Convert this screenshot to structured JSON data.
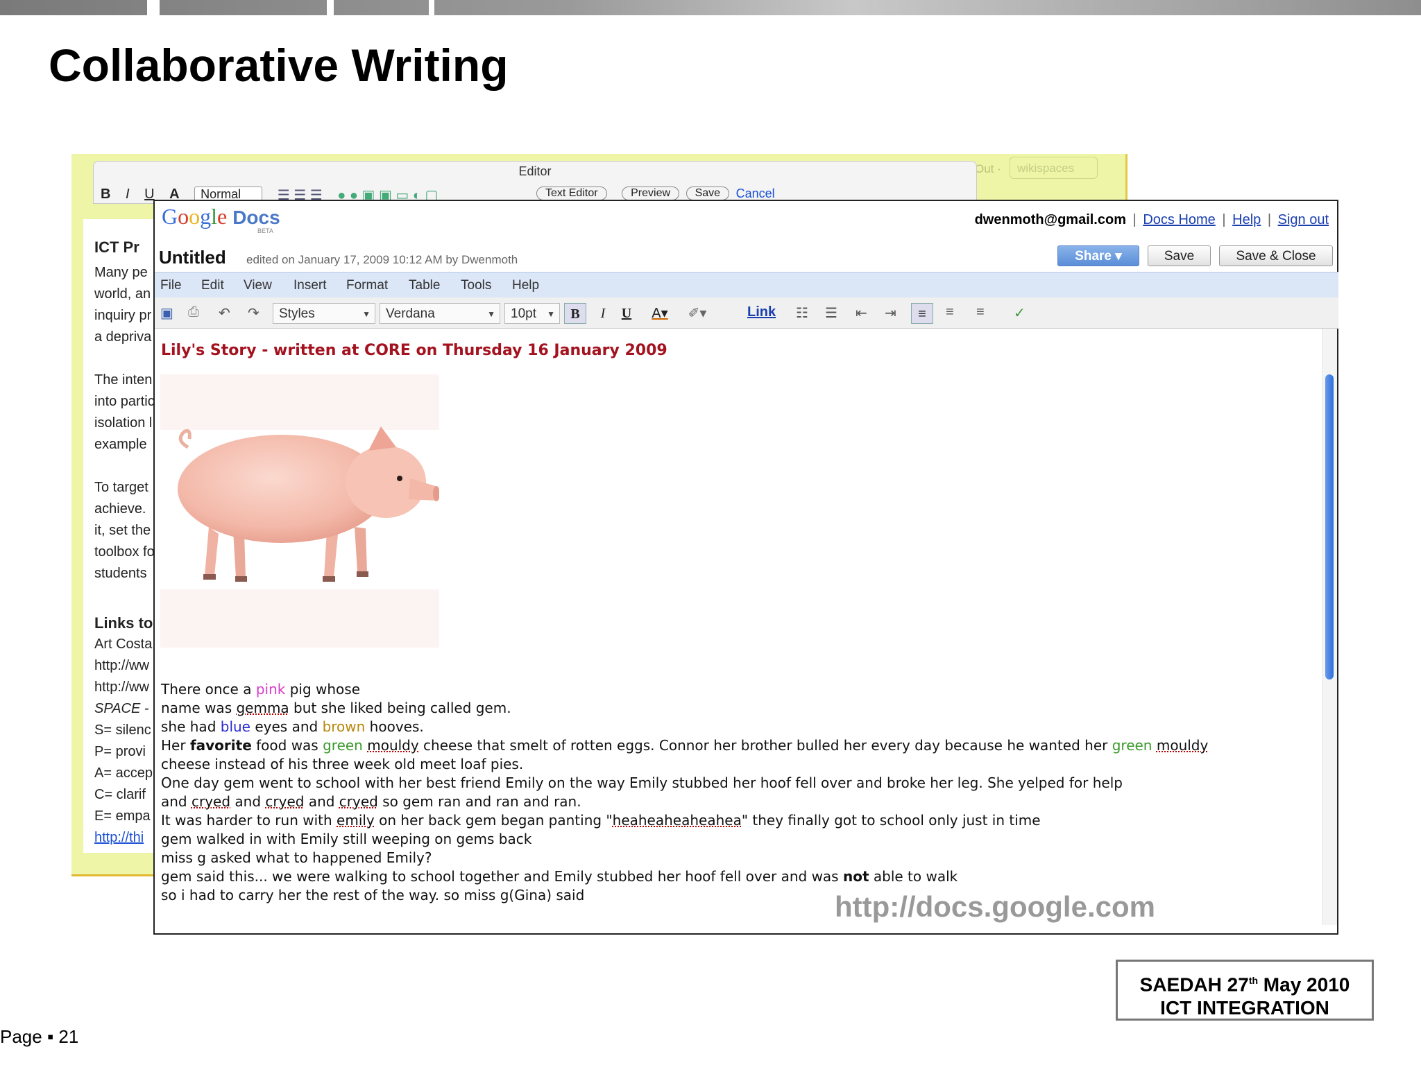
{
  "slide": {
    "title": "Collaborative Writing",
    "caption_url": "http://docs.google.com",
    "footer_line1_pre": "SAEDAH 27",
    "footer_line1_sup": "th",
    "footer_line1_post": " May 2010",
    "footer_line2": "ICT INTEGRATION",
    "page_label": "Page ▪ 21"
  },
  "wiki": {
    "top_right_text": "Out ·",
    "brand": "wikispaces",
    "editor_title": "Editor",
    "toolbar": [
      "B",
      "I",
      "U",
      "A",
      "Normal",
      "Text Editor",
      "Preview",
      "Save",
      "Cancel"
    ],
    "lines": [
      {
        "text": "ICT Pr",
        "style": "h"
      },
      {
        "text": "Many pe",
        "style": ""
      },
      {
        "text": "world, an",
        "style": ""
      },
      {
        "text": "inquiry pr",
        "style": ""
      },
      {
        "text": "a depriva",
        "style": ""
      },
      {
        "text": "The inten",
        "style": ""
      },
      {
        "text": "into partic",
        "style": ""
      },
      {
        "text": "isolation l",
        "style": ""
      },
      {
        "text": "example",
        "style": ""
      },
      {
        "text": "To target",
        "style": ""
      },
      {
        "text": "achieve.",
        "style": ""
      },
      {
        "text": "it, set the",
        "style": ""
      },
      {
        "text": "toolbox fo",
        "style": ""
      },
      {
        "text": "students",
        "style": ""
      },
      {
        "text": "Links to",
        "style": "h"
      },
      {
        "text": "Art Costa",
        "style": ""
      },
      {
        "text": "http://ww",
        "style": ""
      },
      {
        "text": "http://ww",
        "style": ""
      },
      {
        "text": "SPACE -",
        "style": "it"
      },
      {
        "text": "S= silenc",
        "style": ""
      },
      {
        "text": "P= provi",
        "style": ""
      },
      {
        "text": "A= accep",
        "style": ""
      },
      {
        "text": "C= clarif",
        "style": ""
      },
      {
        "text": "E= empa",
        "style": ""
      },
      {
        "text": "http://thi",
        "style": "link"
      }
    ]
  },
  "gdocs": {
    "logo_google": "Google",
    "logo_docs": "Docs",
    "logo_beta": "BETA",
    "account_email": "dwenmoth@gmail.com",
    "account_links": [
      "Docs Home",
      "Help",
      "Sign out"
    ],
    "doc_title": "Untitled",
    "edited_text": "edited on January 17, 2009 10:12 AM by Dwenmoth",
    "share_label": "Share ▾",
    "save_label": "Save",
    "save_close_label": "Save & Close",
    "menu": [
      "File",
      "Edit",
      "View",
      "Insert",
      "Format",
      "Table",
      "Tools",
      "Help"
    ],
    "toolbar": {
      "styles": "Styles",
      "font": "Verdana",
      "size": "10pt",
      "link": "Link"
    },
    "heading": "Lily's Story - written at CORE on Thursday 16 January 2009",
    "story": {
      "l1_a": "There once a ",
      "l1_pink": "pink",
      "l1_b": " pig whose",
      "l2_a": " name was ",
      "l2_sq": "gemma",
      "l2_b": " but she liked being called gem.",
      "l3_a": "she had ",
      "l3_blue": "blue",
      "l3_b": " eyes and ",
      "l3_brown": "brown",
      "l3_c": " hooves.",
      "l4_a": "Her ",
      "l4_bold": "favorite",
      "l4_b": " food was ",
      "l4_green": "green",
      "l4_sp": " ",
      "l4_sq": "mouldy",
      "l4_c": " cheese that smelt of rotten eggs. Connor her brother bulled her every day because he wanted her ",
      "l4_green2": "green",
      "l4_sp2": " ",
      "l4_sq2": "mouldy",
      "l5": "cheese instead of his three week old meet loaf pies.",
      "l6": "One day gem went to school with her best friend Emily on the way Emily stubbed her hoof fell over and broke her leg. She yelped for help",
      "l7_a": "and ",
      "l7_sq1": "cryed",
      "l7_b": " and ",
      "l7_sq2": "cryed",
      "l7_c": " and ",
      "l7_sq3": "cryed",
      "l7_d": " so gem ran and ran and ran.",
      "l8_a": "It was harder to run with ",
      "l8_sq1": "emily",
      "l8_b": " on her back  gem began panting \"",
      "l8_sq2": "heaheaheaheahea",
      "l8_c": "\" they finally got to school only just in time",
      "l9": "gem walked in with Emily still weeping on gems back",
      "l10": "miss g asked what to happened Emily?",
      "l11_a": "gem said this... we were walking to school together and Emily stubbed her hoof fell over and was ",
      "l11_bold": "not",
      "l11_b": " able to walk",
      "l12": "so  i had to carry her the rest of the way. so miss g(Gina) said"
    }
  }
}
